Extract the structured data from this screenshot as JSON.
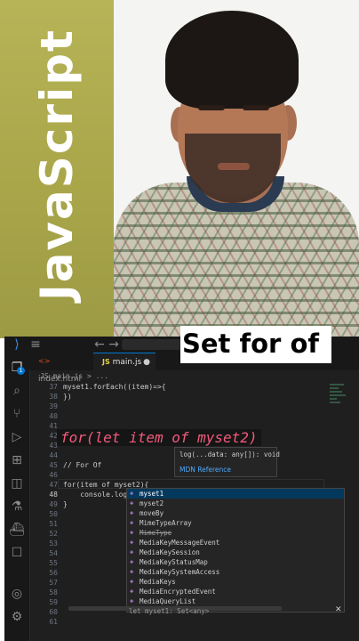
{
  "left_title": "JavaScript",
  "overlay_title": "Set for of",
  "editor": {
    "tabs": [
      "index.html",
      "main.js"
    ],
    "breadcrumb": "JS main.js > ...",
    "line_numbers": [
      "37",
      "38",
      "39",
      "40",
      "41",
      "42",
      "43",
      "44",
      "45",
      "46",
      "47",
      "48",
      "49",
      "50",
      "51",
      "52",
      "53",
      "54",
      "55",
      "56",
      "57",
      "58",
      "59",
      "60",
      "61"
    ],
    "current_line": "48",
    "code_lines": [
      "myset1.forEach((item)=>{",
      "})",
      "",
      "",
      "",
      "",
      "",
      "",
      "// For Of",
      "",
      "for(item of myset2){",
      "    console.log(\"Myset 2\",my)",
      "}"
    ],
    "big_code": "for(let item of myset2)",
    "signature_help": {
      "signature": "log(...data: any[]): void",
      "link": "MDN Reference"
    },
    "suggestions": [
      {
        "label": "myset1",
        "selected": true,
        "strike": false
      },
      {
        "label": "myset2",
        "selected": false,
        "strike": false
      },
      {
        "label": "moveBy",
        "selected": false,
        "strike": false
      },
      {
        "label": "MimeTypeArray",
        "selected": false,
        "strike": false
      },
      {
        "label": "MimeType",
        "selected": false,
        "strike": true
      },
      {
        "label": "MediaKeyMessageEvent",
        "selected": false,
        "strike": false
      },
      {
        "label": "MediaKeySession",
        "selected": false,
        "strike": false
      },
      {
        "label": "MediaKeyStatusMap",
        "selected": false,
        "strike": false
      },
      {
        "label": "MediaKeySystemAccess",
        "selected": false,
        "strike": false
      },
      {
        "label": "MediaKeys",
        "selected": false,
        "strike": false
      },
      {
        "label": "MediaEncryptedEvent",
        "selected": false,
        "strike": false
      },
      {
        "label": "MediaQueryList",
        "selected": false,
        "strike": false
      }
    ],
    "bottom_text": "let myset1: Set<any>",
    "badge_count": "1"
  },
  "colors": {
    "band": "#a9a64a",
    "keyword_pink": "#f25a7c",
    "editor_bg": "#1f1f1f",
    "selection": "#04395e"
  }
}
